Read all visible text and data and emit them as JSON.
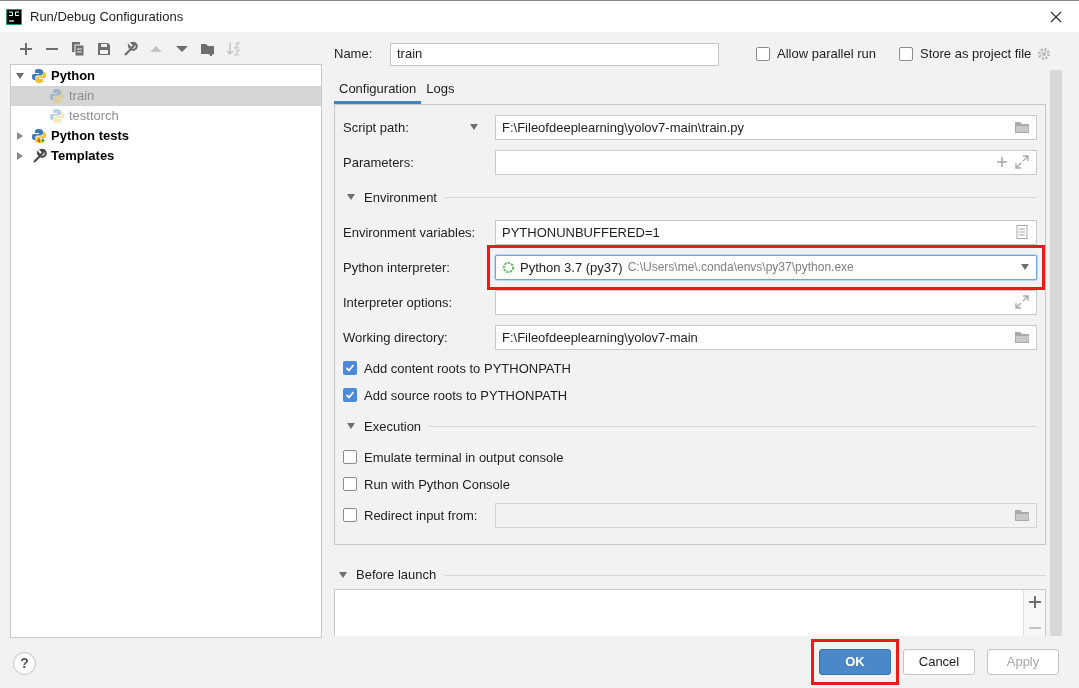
{
  "window": {
    "title": "Run/Debug Configurations"
  },
  "toolbar": [
    {
      "kind": "add",
      "disabled": false
    },
    {
      "kind": "remove",
      "disabled": false
    },
    {
      "kind": "copy",
      "disabled": false
    },
    {
      "kind": "save",
      "disabled": false
    },
    {
      "kind": "wrench",
      "disabled": false
    },
    {
      "kind": "up",
      "disabled": true
    },
    {
      "kind": "down",
      "disabled": false
    },
    {
      "kind": "folder",
      "disabled": false
    },
    {
      "kind": "sort",
      "disabled": true
    }
  ],
  "tree": [
    {
      "label": "Python",
      "kind": "python",
      "expanded": true,
      "selected": false,
      "temporary": false,
      "children": [
        {
          "label": "train",
          "kind": "python",
          "selected": true,
          "temporary": true
        },
        {
          "label": "testtorch",
          "kind": "python",
          "selected": false,
          "temporary": true
        }
      ]
    },
    {
      "label": "Python tests",
      "kind": "python_tests",
      "expanded": false,
      "selected": false,
      "temporary": false
    },
    {
      "label": "Templates",
      "kind": "templates",
      "expanded": false,
      "selected": false,
      "temporary": false
    }
  ],
  "name": {
    "label": "Name:",
    "value": "train"
  },
  "options": [
    {
      "label": "Allow parallel run",
      "checked": false
    },
    {
      "label": "Store as project file",
      "checked": false
    }
  ],
  "tabs": [
    {
      "label": "Configuration",
      "selected": true
    },
    {
      "label": "Logs",
      "selected": false
    }
  ],
  "config": [
    {
      "kind": "field",
      "label": "Script path:",
      "target_menu": true,
      "value": "F:\\Fileofdeeplearning\\yolov7-main\\train.py"
    },
    {
      "kind": "params_field",
      "label": "Parameters:"
    },
    {
      "kind": "section",
      "label": "Environment",
      "expanded": true
    },
    {
      "kind": "env_field",
      "label": "Environment variables:",
      "value": "PYTHONUNBUFFERED=1"
    },
    {
      "kind": "select",
      "label": "Python interpreter:",
      "value": "Python 3.7 (py37)",
      "detail": "C:\\Users\\me\\.conda\\envs\\py37\\python.exe",
      "highlighted": true
    },
    {
      "kind": "options_field",
      "label": "Interpreter options:"
    },
    {
      "kind": "field",
      "label": "Working directory:",
      "value": "F:\\Fileofdeeplearning\\yolov7-main"
    },
    {
      "kind": "checkbox",
      "label": "Add content roots to PYTHONPATH",
      "checked": true
    },
    {
      "kind": "checkbox",
      "label": "Add source roots to PYTHONPATH",
      "checked": true
    },
    {
      "kind": "section",
      "label": "Execution",
      "expanded": true
    },
    {
      "kind": "checkbox",
      "label": "Emulate terminal in output console",
      "checked": false
    },
    {
      "kind": "checkbox",
      "label": "Run with Python Console",
      "checked": false
    },
    {
      "kind": "checkbox_field",
      "label": "Redirect input from:",
      "checked": false
    }
  ],
  "before_launch": {
    "label": "Before launch",
    "expanded": true,
    "actions": [
      {
        "kind": "add",
        "disabled": false
      },
      {
        "kind": "remove",
        "disabled": true
      }
    ]
  },
  "help": "?",
  "buttons": [
    {
      "label": "OK",
      "kind": "primary",
      "disabled": false,
      "highlighted": true
    },
    {
      "label": "Cancel",
      "kind": "normal",
      "disabled": false,
      "highlighted": false
    },
    {
      "label": "Apply",
      "kind": "normal",
      "disabled": true,
      "highlighted": false
    }
  ]
}
